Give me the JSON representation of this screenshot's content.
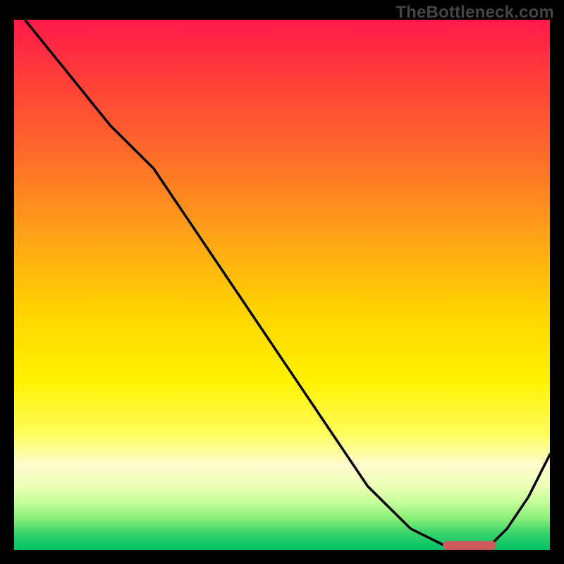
{
  "watermark": "TheBottleneck.com",
  "chart_data": {
    "type": "line",
    "title": "",
    "xlabel": "",
    "ylabel": "",
    "xlim": [
      0,
      100
    ],
    "ylim": [
      0,
      100
    ],
    "background_gradient": {
      "stops": [
        {
          "pos": 0.0,
          "color": "#ff1a4b"
        },
        {
          "pos": 0.1,
          "color": "#ff3a3a"
        },
        {
          "pos": 0.25,
          "color": "#ff6a2a"
        },
        {
          "pos": 0.4,
          "color": "#ffa019"
        },
        {
          "pos": 0.55,
          "color": "#ffd400"
        },
        {
          "pos": 0.68,
          "color": "#fff200"
        },
        {
          "pos": 0.78,
          "color": "#fffd5c"
        },
        {
          "pos": 0.84,
          "color": "#fffccf"
        },
        {
          "pos": 0.88,
          "color": "#edffb5"
        },
        {
          "pos": 0.91,
          "color": "#c4ff9a"
        },
        {
          "pos": 0.94,
          "color": "#8aef7a"
        },
        {
          "pos": 0.97,
          "color": "#34d36b"
        },
        {
          "pos": 1.0,
          "color": "#00c066"
        }
      ]
    },
    "series": [
      {
        "name": "bottleneck-curve",
        "color": "#000000",
        "x": [
          2,
          10,
          18,
          26,
          34,
          42,
          50,
          58,
          66,
          74,
          80,
          84,
          88,
          92,
          96,
          100
        ],
        "values": [
          100,
          90,
          80,
          72,
          60,
          48,
          36,
          24,
          12,
          4,
          1,
          0,
          0,
          4,
          10,
          18
        ]
      }
    ],
    "highlight_bar": {
      "color": "#cc5a5a",
      "x_start": 80,
      "x_end": 90,
      "y": 0,
      "thickness": 1.7
    }
  }
}
